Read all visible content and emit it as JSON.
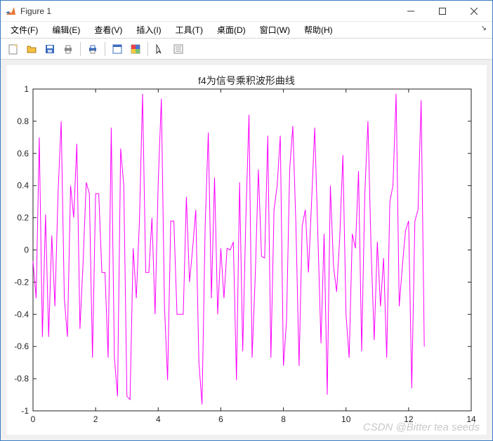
{
  "window": {
    "title": "Figure 1"
  },
  "menu": {
    "file": "文件(F)",
    "edit": "编辑(E)",
    "view": "查看(V)",
    "insert": "插入(I)",
    "tools": "工具(T)",
    "desktop": "桌面(D)",
    "window": "窗口(W)",
    "help": "帮助(H)"
  },
  "chart_data": {
    "type": "line",
    "title": "f4为信号乘积波形曲线",
    "xlabel": "",
    "ylabel": "",
    "xlim": [
      0,
      14
    ],
    "ylim": [
      -1,
      1
    ],
    "xticks": [
      0,
      2,
      4,
      6,
      8,
      10,
      12,
      14
    ],
    "yticks": [
      -1,
      -0.8,
      -0.6,
      -0.4,
      -0.2,
      0,
      0.2,
      0.4,
      0.6,
      0.8,
      1
    ],
    "line_color": "#ff00ff",
    "x": [
      0,
      0.1,
      0.2,
      0.3,
      0.4,
      0.5,
      0.6,
      0.7,
      0.8,
      0.9,
      1,
      1.1,
      1.2,
      1.3,
      1.4,
      1.5,
      1.6,
      1.7,
      1.8,
      1.9,
      2,
      2.1,
      2.2,
      2.3,
      2.4,
      2.5,
      2.6,
      2.7,
      2.8,
      2.9,
      3,
      3.1,
      3.2,
      3.3,
      3.4,
      3.5,
      3.6,
      3.7,
      3.8,
      3.9,
      4,
      4.1,
      4.2,
      4.3,
      4.4,
      4.5,
      4.6,
      4.7,
      4.8,
      4.9,
      5,
      5.1,
      5.2,
      5.3,
      5.4,
      5.5,
      5.6,
      5.7,
      5.8,
      5.9,
      6,
      6.1,
      6.2,
      6.3,
      6.4,
      6.5,
      6.6,
      6.7,
      6.8,
      6.9,
      7,
      7.1,
      7.2,
      7.3,
      7.4,
      7.5,
      7.6,
      7.7,
      7.8,
      7.9,
      8,
      8.1,
      8.2,
      8.3,
      8.4,
      8.5,
      8.6,
      8.7,
      8.8,
      8.9,
      9,
      9.1,
      9.2,
      9.3,
      9.4,
      9.5,
      9.6,
      9.7,
      9.8,
      9.9,
      10,
      10.1,
      10.2,
      10.3,
      10.4,
      10.5,
      10.6,
      10.7,
      10.8,
      10.9,
      11,
      11.1,
      11.2,
      11.3,
      11.4,
      11.5,
      11.6,
      11.7,
      11.8,
      11.9,
      12,
      12.1,
      12.2,
      12.3,
      12.4,
      12.5
    ],
    "values": [
      -0.07,
      -0.3,
      0.7,
      -0.54,
      0.22,
      -0.54,
      0.09,
      -0.35,
      0.35,
      0.8,
      -0.3,
      -0.54,
      0.4,
      0.2,
      0.66,
      -0.49,
      -0.08,
      0.42,
      0.35,
      -0.67,
      0.35,
      0.35,
      -0.14,
      -0.14,
      -0.67,
      0.76,
      -0.67,
      -0.91,
      0.63,
      0.4,
      -0.91,
      -0.93,
      0.01,
      -0.3,
      0.18,
      0.97,
      -0.14,
      -0.14,
      0.2,
      -0.4,
      0.42,
      0.94,
      -0.35,
      -0.81,
      0.18,
      0.18,
      -0.4,
      -0.4,
      -0.4,
      0.33,
      -0.2,
      0.01,
      0.25,
      -0.7,
      -0.96,
      0.15,
      0.73,
      -0.3,
      0.45,
      -0.4,
      0.01,
      -0.3,
      0.01,
      -0.0,
      0.05,
      -0.81,
      0.42,
      -0.63,
      0.2,
      0.84,
      -0.67,
      -0.16,
      0.5,
      -0.04,
      -0.05,
      0.71,
      -0.67,
      0.25,
      0.4,
      0.71,
      -0.72,
      -0.44,
      0.5,
      0.77,
      0.15,
      -0.72,
      0.15,
      0.25,
      -0.14,
      0.3,
      0.76,
      0.1,
      -0.58,
      0.1,
      -0.9,
      0.4,
      -0.1,
      -0.26,
      0.08,
      0.59,
      -0.4,
      -0.67,
      0.1,
      0.01,
      0.49,
      -0.63,
      0.35,
      0.8,
      0.01,
      -0.56,
      0.05,
      -0.35,
      -0.05,
      -0.67,
      0.3,
      0.4,
      0.97,
      -0.35,
      -0.1,
      0.12,
      0.18,
      -0.86,
      0.18,
      0.25,
      0.93,
      -0.6
    ]
  },
  "watermark": "CSDN @Bitter tea seeds"
}
